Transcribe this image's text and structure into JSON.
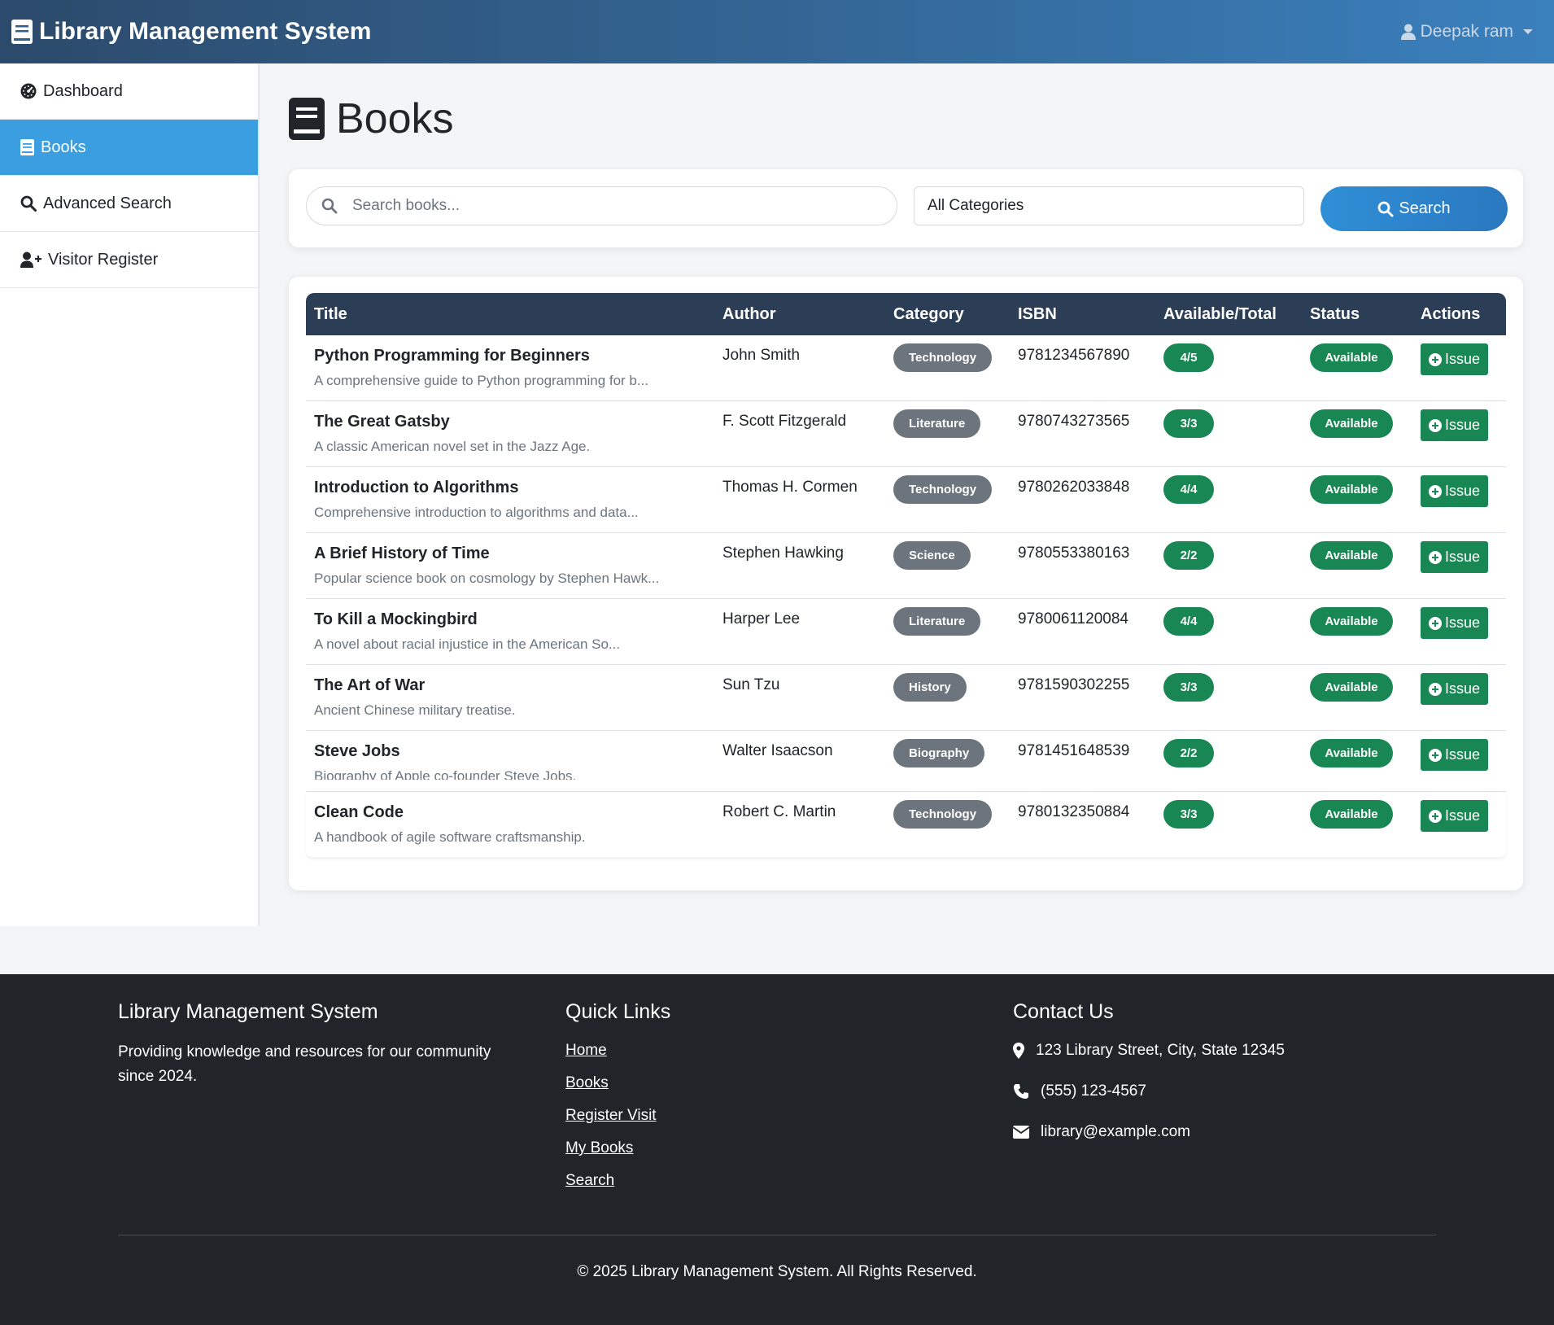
{
  "navbar": {
    "brand": "Library Management System",
    "user": "Deepak ram"
  },
  "sidebar": {
    "items": [
      {
        "label": "Dashboard",
        "icon": "gauge-icon"
      },
      {
        "label": "Books",
        "icon": "book-icon",
        "active": true
      },
      {
        "label": "Advanced Search",
        "icon": "search-icon"
      },
      {
        "label": "Visitor Register",
        "icon": "user-plus-icon"
      }
    ]
  },
  "page": {
    "title": "Books"
  },
  "search": {
    "placeholder": "Search books...",
    "category": "All Categories",
    "button": "Search"
  },
  "table": {
    "headers": [
      "Title",
      "Author",
      "Category",
      "ISBN",
      "Available/Total",
      "Status",
      "Actions"
    ],
    "rows": [
      {
        "title": "Python Programming for Beginners",
        "desc": "A comprehensive guide to Python programming for b...",
        "author": "John Smith",
        "category": "Technology",
        "isbn": "9781234567890",
        "avail": "4/5",
        "status": "Available",
        "action": "Issue"
      },
      {
        "title": "The Great Gatsby",
        "desc": "A classic American novel set in the Jazz Age.",
        "author": "F. Scott Fitzgerald",
        "category": "Literature",
        "isbn": "9780743273565",
        "avail": "3/3",
        "status": "Available",
        "action": "Issue"
      },
      {
        "title": "Introduction to Algorithms",
        "desc": "Comprehensive introduction to algorithms and data...",
        "author": "Thomas H. Cormen",
        "category": "Technology",
        "isbn": "9780262033848",
        "avail": "4/4",
        "status": "Available",
        "action": "Issue"
      },
      {
        "title": "A Brief History of Time",
        "desc": "Popular science book on cosmology by Stephen Hawk...",
        "author": "Stephen Hawking",
        "category": "Science",
        "isbn": "9780553380163",
        "avail": "2/2",
        "status": "Available",
        "action": "Issue"
      },
      {
        "title": "To Kill a Mockingbird",
        "desc": "A novel about racial injustice in the American So...",
        "author": "Harper Lee",
        "category": "Literature",
        "isbn": "9780061120084",
        "avail": "4/4",
        "status": "Available",
        "action": "Issue"
      },
      {
        "title": "The Art of War",
        "desc": "Ancient Chinese military treatise.",
        "author": "Sun Tzu",
        "category": "History",
        "isbn": "9781590302255",
        "avail": "3/3",
        "status": "Available",
        "action": "Issue"
      },
      {
        "title": "Steve Jobs",
        "desc": "Biography of Apple co-founder Steve Jobs.",
        "author": "Walter Isaacson",
        "category": "Biography",
        "isbn": "9781451648539",
        "avail": "2/2",
        "status": "Available",
        "action": "Issue"
      },
      {
        "title": "Clean Code",
        "desc": "A handbook of agile software craftsmanship.",
        "author": "Robert C. Martin",
        "category": "Technology",
        "isbn": "9780132350884",
        "avail": "3/3",
        "status": "Available",
        "action": "Issue"
      }
    ]
  },
  "footer": {
    "about_title": "Library Management System",
    "about_text": "Providing knowledge and resources for our community since 2024.",
    "links_title": "Quick Links",
    "links": [
      "Home",
      "Books",
      "Register Visit",
      "My Books",
      "Search"
    ],
    "contact_title": "Contact Us",
    "address": "123 Library Street, City, State 12345",
    "phone": "(555) 123-4567",
    "email": "library@example.com",
    "copyright": "© 2025 Library Management System. All Rights Reserved."
  },
  "colors": {
    "nav_start": "#2c4a6b",
    "nav_end": "#3a80bd",
    "accent": "#3b9ee0",
    "table_header": "#2c3e55",
    "success": "#198754",
    "badge_gray": "#6c757d",
    "footer": "#212529"
  }
}
